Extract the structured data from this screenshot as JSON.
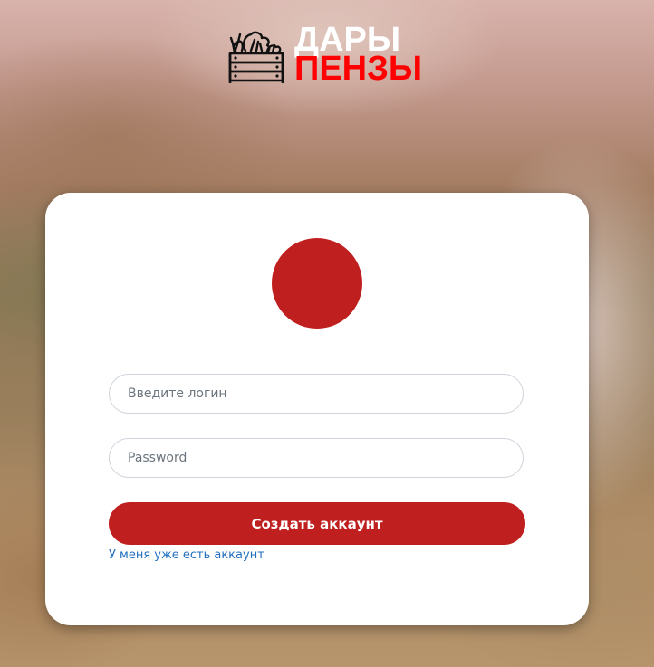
{
  "logo": {
    "line1": "ДАРЫ",
    "line2": "ПЕНЗЫ",
    "icon": "vegetable-crate-icon",
    "line1_color": "#ffffff",
    "line2_color": "#ff0000"
  },
  "form": {
    "login_placeholder": "Введите логин",
    "password_placeholder": "Password",
    "submit_label": "Создать аккаунт",
    "login_link": "У меня уже есть аккаунт"
  },
  "colors": {
    "accent": "#c01f1f",
    "link": "#1f6fbf"
  }
}
